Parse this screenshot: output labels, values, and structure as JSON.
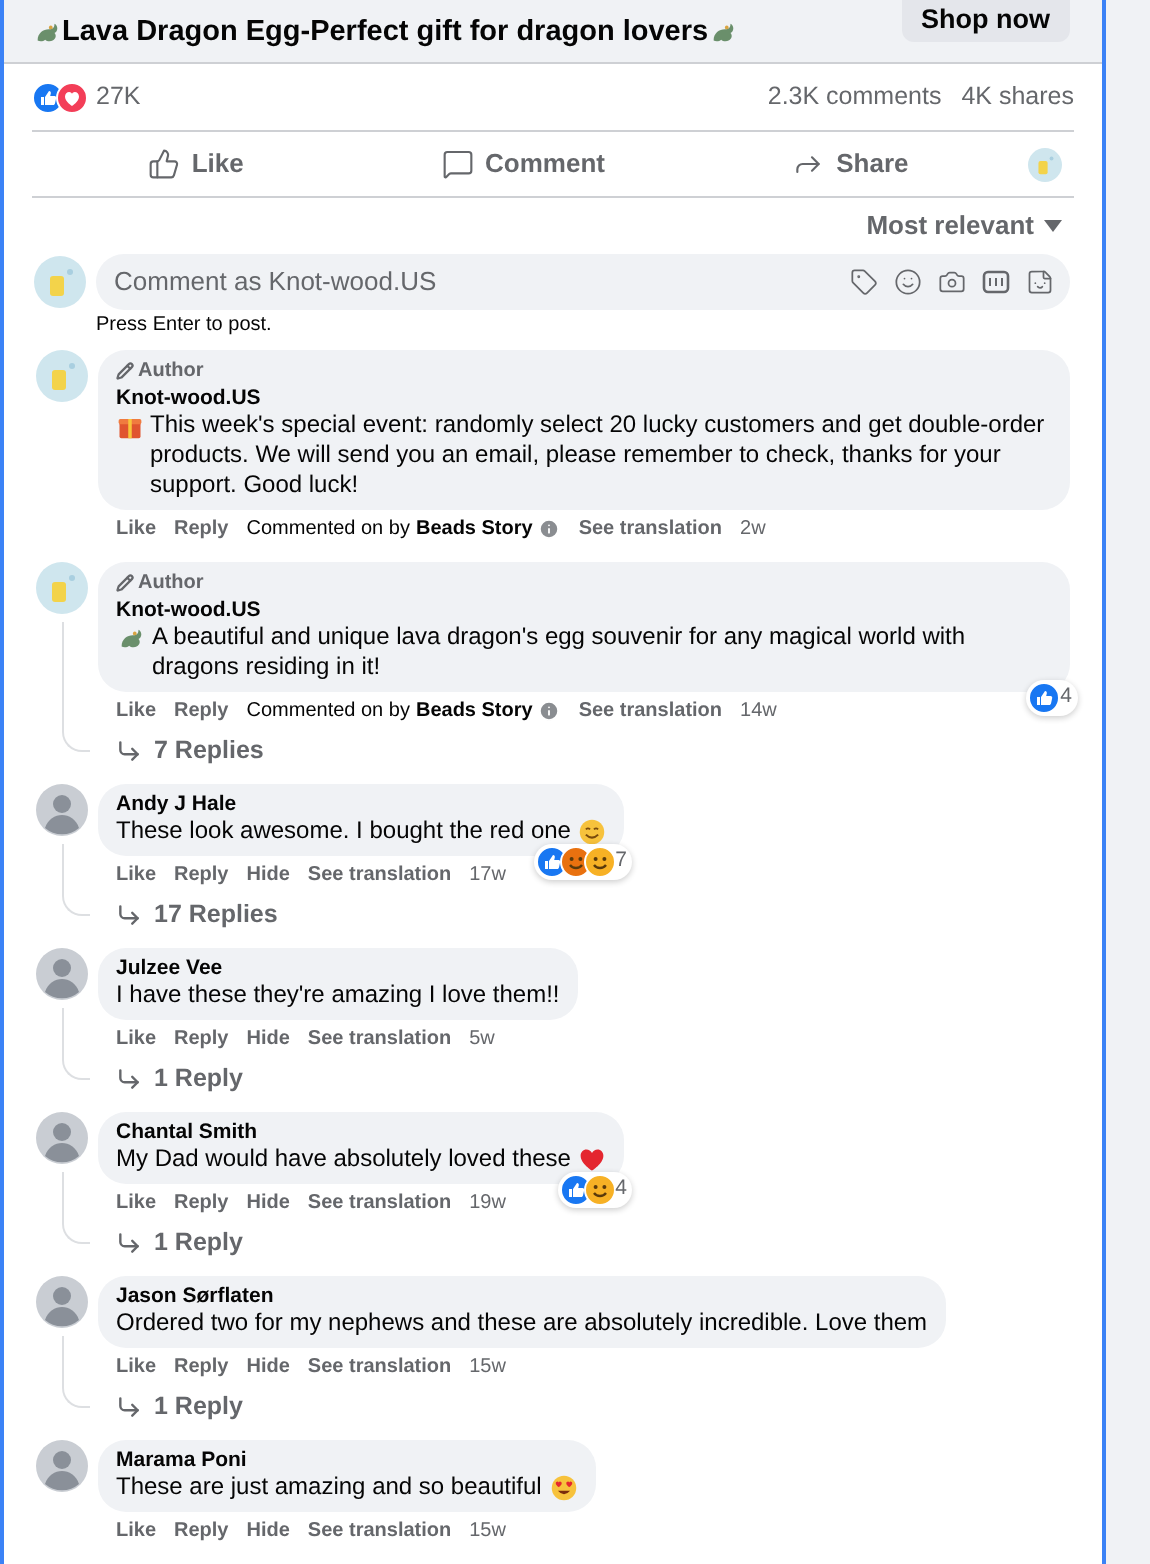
{
  "post": {
    "title": "Lava Dragon Egg-Perfect gift for dragon lovers",
    "title_icon": {
      "kind": "dragon"
    },
    "shop_button": "Shop now"
  },
  "stats": {
    "reactions": [
      {
        "kind": "like"
      },
      {
        "kind": "love"
      }
    ],
    "reaction_count": "27K",
    "comments": "2.3K comments",
    "shares": "4K shares"
  },
  "actions": [
    {
      "kind": "like",
      "label": "Like"
    },
    {
      "kind": "comment",
      "label": "Comment"
    },
    {
      "kind": "share",
      "label": "Share"
    }
  ],
  "sort": {
    "label": "Most relevant"
  },
  "composer": {
    "placeholder": "Comment as Knot-wood.US",
    "hint": "Press Enter to post."
  },
  "comments": [
    {
      "avatar": {
        "kind": "page"
      },
      "badge": "Author",
      "name": "Knot-wood.US",
      "lead_icon": {
        "kind": "gift"
      },
      "text": "This week's special event: randomly select 20 lucky customers and get double-order products. We will send you an email, please remember to check, thanks for your support. Good luck!",
      "actions": [
        "Like",
        "Reply"
      ],
      "commented_on": {
        "prefix": "Commented on by",
        "page": "Beads Story"
      },
      "translate": "See translation",
      "time": "2w"
    },
    {
      "avatar": {
        "kind": "page"
      },
      "badge": "Author",
      "name": "Knot-wood.US",
      "lead_icon": {
        "kind": "dragon"
      },
      "text": "A beautiful and unique lava dragon's egg souvenir for any magical world with dragons residing in it!",
      "actions": [
        "Like",
        "Reply"
      ],
      "commented_on": {
        "prefix": "Commented on by",
        "page": "Beads Story"
      },
      "translate": "See translation",
      "time": "14w",
      "reactions": {
        "types": [
          {
            "kind": "like"
          }
        ],
        "count": "4"
      },
      "replies": "7 Replies"
    },
    {
      "avatar": {
        "kind": "person"
      },
      "name": "Andy J Hale",
      "text": "These look awesome. I bought the red one",
      "trail_icon": {
        "kind": "smile"
      },
      "actions": [
        "Like",
        "Reply",
        "Hide"
      ],
      "translate": "See translation",
      "time": "17w",
      "reactions": {
        "types": [
          {
            "kind": "like"
          },
          {
            "kind": "angry"
          },
          {
            "kind": "haha"
          }
        ],
        "count": "7"
      },
      "replies": "17 Replies"
    },
    {
      "avatar": {
        "kind": "person"
      },
      "name": "Julzee Vee",
      "text": "I have these they're amazing I love them!!",
      "actions": [
        "Like",
        "Reply",
        "Hide"
      ],
      "translate": "See translation",
      "time": "5w",
      "replies": "1 Reply"
    },
    {
      "avatar": {
        "kind": "person"
      },
      "name": "Chantal Smith",
      "text": "My Dad would have absolutely loved these",
      "trail_icon": {
        "kind": "heart"
      },
      "actions": [
        "Like",
        "Reply",
        "Hide"
      ],
      "translate": "See translation",
      "time": "19w",
      "reactions": {
        "types": [
          {
            "kind": "like"
          },
          {
            "kind": "care"
          }
        ],
        "count": "4"
      },
      "replies": "1 Reply"
    },
    {
      "avatar": {
        "kind": "person"
      },
      "name": "Jason Sørflaten",
      "text": "Ordered two for my nephews and these are absolutely incredible. Love them",
      "actions": [
        "Like",
        "Reply",
        "Hide"
      ],
      "translate": "See translation",
      "time": "15w",
      "replies": "1 Reply"
    },
    {
      "avatar": {
        "kind": "person"
      },
      "name": "Marama Poni",
      "text": "These are just amazing and so beautiful",
      "trail_icon": {
        "kind": "heart-eyes"
      },
      "actions": [
        "Like",
        "Reply",
        "Hide"
      ],
      "translate": "See translation",
      "time": "15w"
    }
  ]
}
